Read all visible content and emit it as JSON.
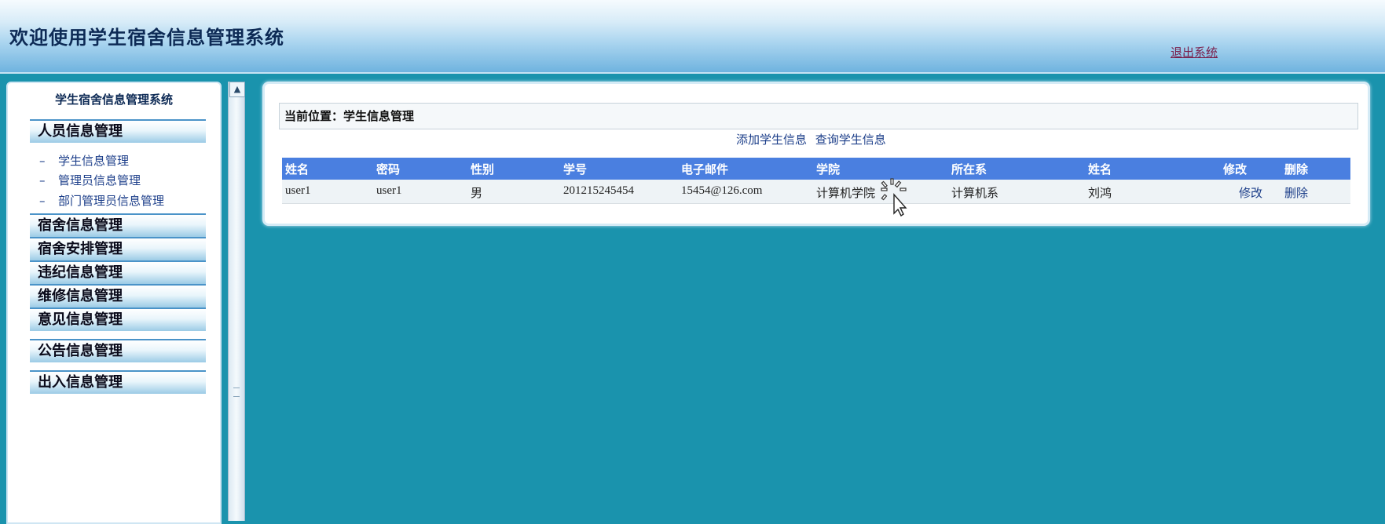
{
  "header": {
    "title": "欢迎使用学生宿舍信息管理系统",
    "logout": "退出系统"
  },
  "sidebar": {
    "title": "学生宿舍信息管理系统",
    "sections": [
      {
        "label": "人员信息管理"
      },
      {
        "label": "宿舍信息管理"
      },
      {
        "label": "宿舍安排管理"
      },
      {
        "label": "违纪信息管理"
      },
      {
        "label": "维修信息管理"
      },
      {
        "label": "意见信息管理"
      },
      {
        "label": "公告信息管理"
      },
      {
        "label": "出入信息管理"
      }
    ],
    "sub_items": [
      {
        "dash": "–",
        "label": "学生信息管理"
      },
      {
        "dash": "–",
        "label": "管理员信息管理"
      },
      {
        "dash": "–",
        "label": "部门管理员信息管理"
      }
    ]
  },
  "main": {
    "location": "当前位置：学生信息管理",
    "actions": {
      "add": "添加学生信息",
      "query": "查询学生信息"
    },
    "table": {
      "headers": [
        "姓名",
        "密码",
        "性别",
        "学号",
        "电子邮件",
        "学院",
        "所在系",
        "姓名",
        "修改",
        "删除"
      ],
      "rows": [
        {
          "name": "user1",
          "password": "user1",
          "gender": "男",
          "student_id": "201215245454",
          "email": "15454@126.com",
          "college": "计算机学院",
          "department": "计算机系",
          "real_name": "刘鸿",
          "edit": "修改",
          "delete": "删除"
        }
      ]
    }
  },
  "icons": {
    "splitter_arrow": "▲",
    "cursor": "busy-pointer-icon"
  }
}
